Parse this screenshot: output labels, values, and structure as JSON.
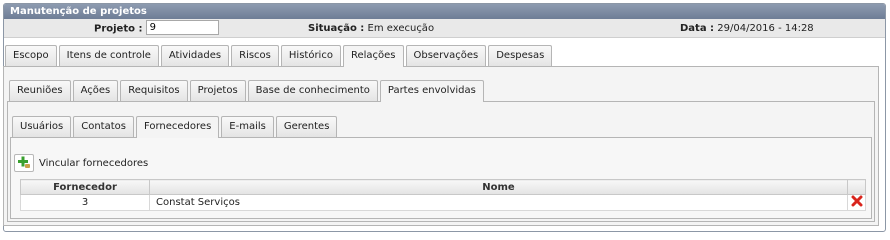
{
  "window": {
    "title": "Manutenção de projetos"
  },
  "info": {
    "projeto_label": "Projeto :",
    "projeto_value": "9",
    "situacao_label": "Situação :",
    "situacao_value": "Em execução",
    "data_label": "Data :",
    "data_value": "29/04/2016 - 14:28"
  },
  "main_tabs": [
    "Escopo",
    "Itens de controle",
    "Atividades",
    "Riscos",
    "Histórico",
    "Relações",
    "Observações",
    "Despesas"
  ],
  "relacoes_tabs": [
    "Reuniões",
    "Ações",
    "Requisitos",
    "Projetos",
    "Base de conhecimento",
    "Partes envolvidas"
  ],
  "partes_tabs": [
    "Usuários",
    "Contatos",
    "Fornecedores",
    "E-mails",
    "Gerentes"
  ],
  "action": {
    "link_label": "Vincular fornecedores",
    "icon": "add-link-icon"
  },
  "table": {
    "headers": {
      "fornecedor": "Fornecedor",
      "nome": "Nome"
    },
    "rows": [
      {
        "fornecedor": "3",
        "nome": "Constat Serviços"
      }
    ]
  },
  "colors": {
    "titlebar": "#7f8ea6",
    "delete_icon": "#d9251d",
    "add_icon": "#3aa02f"
  }
}
